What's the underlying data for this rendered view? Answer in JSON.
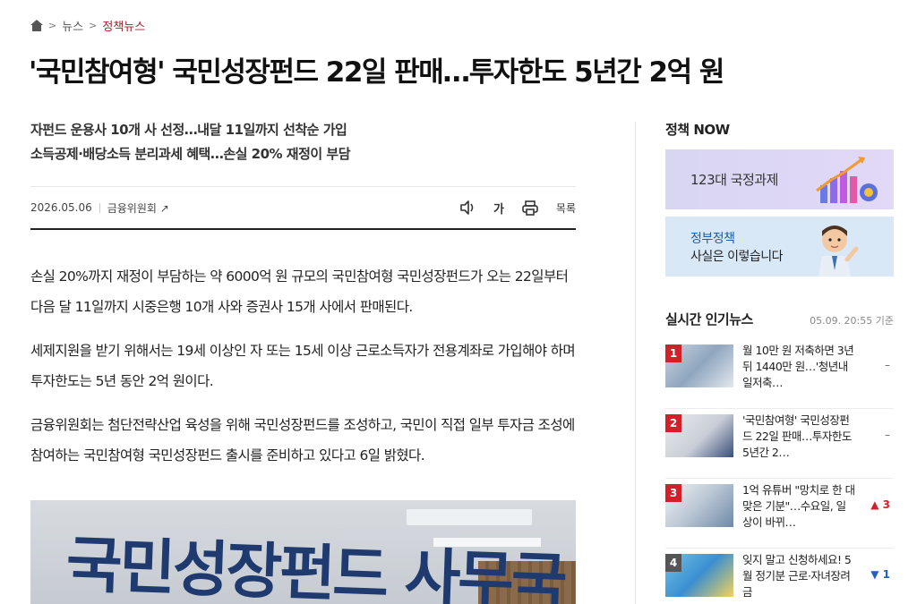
{
  "breadcrumb": {
    "level1": "뉴스",
    "level2": "정책뉴스"
  },
  "article": {
    "headline": "'국민참여형' 국민성장펀드 22일 판매…투자한도 5년간 2억 원",
    "subheads": [
      "자펀드 운용사 10개 사 선정…내달 11일까지 선착순 가입",
      "소득공제·배당소득 분리과세 혜택…손실 20% 재정이 부담"
    ],
    "date": "2026.05.06",
    "source": "금융위원회 ↗",
    "tools": {
      "font_label": "가",
      "list_label": "목록"
    },
    "paragraphs": [
      "손실 20%까지 재정이 부담하는 약 6000억 원 규모의 국민참여형 국민성장펀드가 오는 22일부터 다음 달 11일까지 시중은행 10개 사와 증권사 15개 사에서 판매된다.",
      "세제지원을 받기 위해서는 19세 이상인 자 또는 15세 이상 근로소득자가 전용계좌로 가입해야 하며 투자한도는 5년 동안 2억 원이다.",
      "금융위원회는 첨단전략산업 육성을 위해 국민성장펀드를 조성하고, 국민이 직접 일부 투자금 조성에 참여하는 국민참여형 국민성장펀드 출시를 준비하고 있다고 6일 밝혔다."
    ],
    "photo_sign": "국민성장펀드 사무국"
  },
  "sidebar": {
    "policy_now_title": "정책 NOW",
    "banner1": "123대 국정과제",
    "banner2_line1": "정부정책",
    "banner2_line2": "사실은 이렇습니다",
    "popular_title": "실시간 인기뉴스",
    "popular_time": "05.09. 20:55 기준",
    "popular": [
      {
        "rank": "1",
        "text": "월 10만 원 저축하면 3년 뒤 1440만 원…'청년내일저축…",
        "change": "–",
        "dir": "same"
      },
      {
        "rank": "2",
        "text": "'국민참여형' 국민성장펀드 22일 판매…투자한도 5년간 2…",
        "change": "–",
        "dir": "same"
      },
      {
        "rank": "3",
        "text": "1억 유튜버 \"망치로 한 대 맞은 기분\"…수요일, 일상이 바뀌…",
        "change": "▲ 3",
        "dir": "up"
      },
      {
        "rank": "4",
        "text": "잊지 말고 신청하세요! 5월 정기분 근로·자녀장려금",
        "change": "▼ 1",
        "dir": "down"
      }
    ]
  },
  "colors": {
    "accent_red": "#d21f2a",
    "breadcrumb_current": "#a0212b",
    "link_blue": "#1d5ea8"
  }
}
